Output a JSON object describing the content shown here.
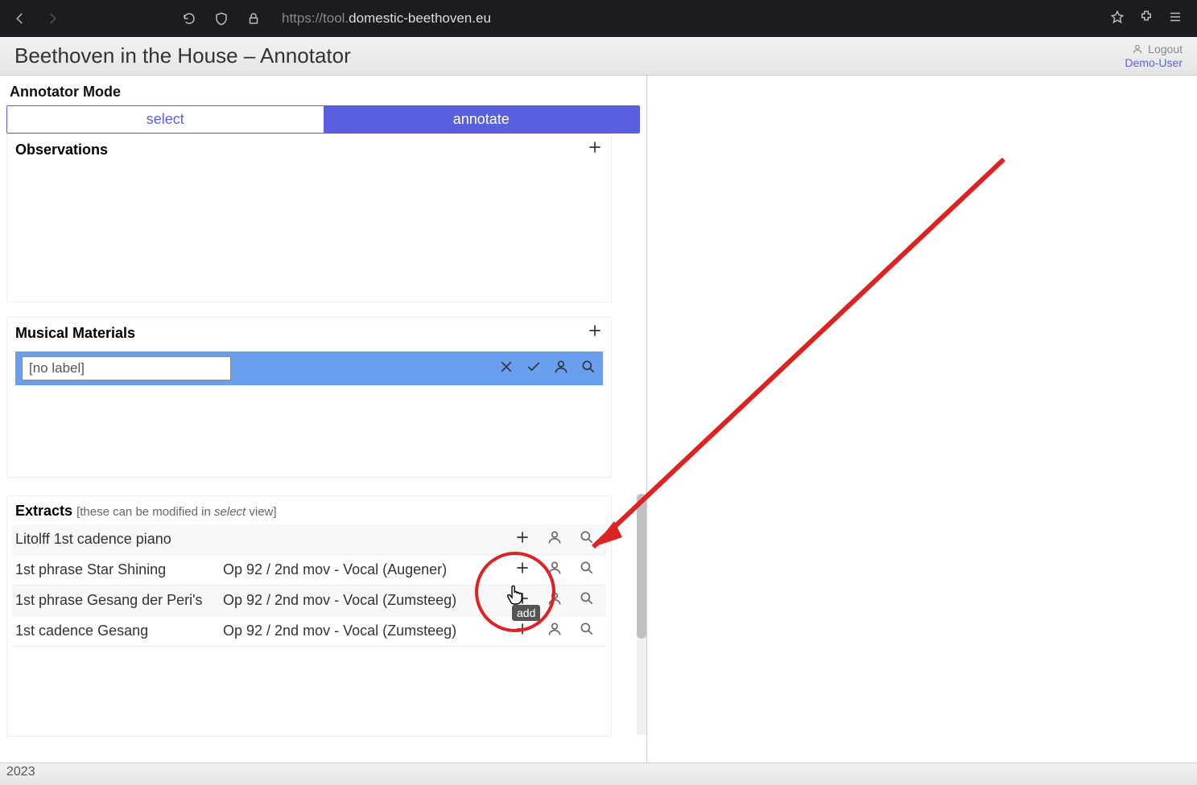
{
  "browser": {
    "url_prefix": "https://tool.",
    "url_domain": "domestic-beethoven.eu"
  },
  "header": {
    "title": "Beethoven in the House – Annotator",
    "logout": "Logout",
    "user": "Demo-User"
  },
  "mode": {
    "label": "Annotator Mode",
    "select": "select",
    "annotate": "annotate"
  },
  "observations": {
    "title": "Observations"
  },
  "materials": {
    "title": "Musical Materials",
    "input_value": "[no label]"
  },
  "extracts": {
    "title": "Extracts",
    "hint_pre": "[these can be modified in ",
    "hint_em": "select",
    "hint_post": " view]",
    "rows": [
      {
        "name": "Litolff 1st cadence piano",
        "src": ""
      },
      {
        "name": "1st phrase Star Shining",
        "src": "Op 92 / 2nd mov - Vocal (Augener)"
      },
      {
        "name": "1st phrase Gesang der Peri's",
        "src": "Op 92 / 2nd mov - Vocal (Zumsteeg)"
      },
      {
        "name": "1st cadence Gesang",
        "src": "Op 92 / 2nd mov - Vocal (Zumsteeg)"
      }
    ]
  },
  "tooltip": "add",
  "footer": "2023"
}
